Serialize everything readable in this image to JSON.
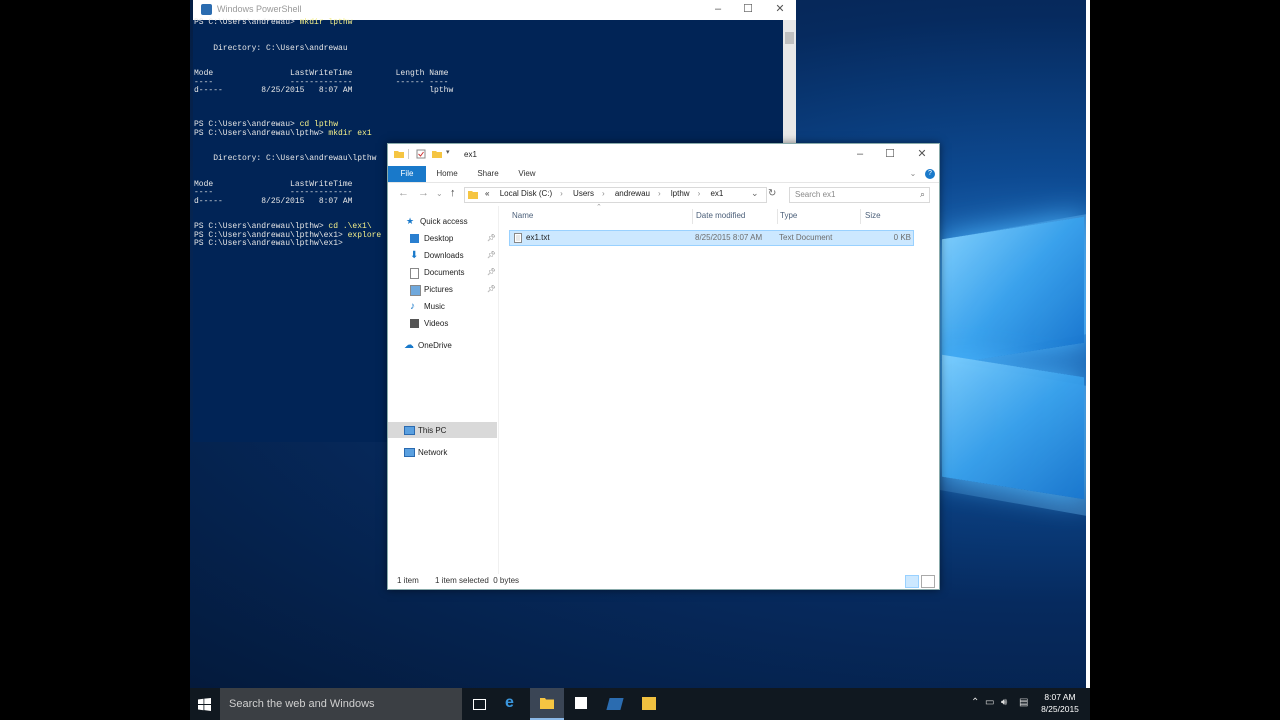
{
  "powershell": {
    "title": "Windows PowerShell",
    "lines": [
      {
        "prompt": "PS C:\\Users\\andrewau> ",
        "cmd": "mkdir lpthw"
      },
      {
        "text": ""
      },
      {
        "text": ""
      },
      {
        "text": "    Directory: C:\\Users\\andrewau"
      },
      {
        "text": ""
      },
      {
        "text": ""
      },
      {
        "text": "Mode                LastWriteTime         Length Name"
      },
      {
        "text": "----                -------------         ------ ----"
      },
      {
        "text": "d-----        8/25/2015   8:07 AM                lpthw"
      },
      {
        "text": ""
      },
      {
        "text": ""
      },
      {
        "text": ""
      },
      {
        "prompt": "PS C:\\Users\\andrewau> ",
        "cmd": "cd lpthw"
      },
      {
        "prompt": "PS C:\\Users\\andrewau\\lpthw> ",
        "cmd": "mkdir ex1"
      },
      {
        "text": ""
      },
      {
        "text": ""
      },
      {
        "text": "    Directory: C:\\Users\\andrewau\\lpthw"
      },
      {
        "text": ""
      },
      {
        "text": ""
      },
      {
        "text": "Mode                LastWriteTime"
      },
      {
        "text": "----                -------------"
      },
      {
        "text": "d-----        8/25/2015   8:07 AM"
      },
      {
        "text": ""
      },
      {
        "text": ""
      },
      {
        "prompt": "PS C:\\Users\\andrewau\\lpthw> ",
        "cmd": "cd .\\ex1\\"
      },
      {
        "prompt": "PS C:\\Users\\andrewau\\lpthw\\ex1> ",
        "cmd": "explore"
      },
      {
        "prompt": "PS C:\\Users\\andrewau\\lpthw\\ex1> ",
        "cmd": ""
      }
    ]
  },
  "explorer": {
    "title": "ex1",
    "tabs": [
      "File",
      "Home",
      "Share",
      "View"
    ],
    "breadcrumb_prefix": "«",
    "breadcrumbs": [
      "Local Disk (C:)",
      "Users",
      "andrewau",
      "lpthw",
      "ex1"
    ],
    "search_placeholder": "Search ex1",
    "nav": {
      "quick_access": "Quick access",
      "pinned": [
        "Desktop",
        "Downloads",
        "Documents",
        "Pictures"
      ],
      "unpinned": [
        "Music",
        "Videos"
      ],
      "onedrive": "OneDrive",
      "this_pc": "This PC",
      "network": "Network"
    },
    "columns": [
      "Name",
      "Date modified",
      "Type",
      "Size"
    ],
    "files": [
      {
        "name": "ex1.txt",
        "modified": "8/25/2015 8:07 AM",
        "type": "Text Document",
        "size": "0 KB"
      }
    ],
    "status_items": "1 item",
    "status_selected": "1 item selected  0 bytes"
  },
  "taskbar": {
    "search_placeholder": "Search the web and Windows",
    "time": "8:07 AM",
    "date": "8/25/2015"
  },
  "colors": {
    "ps_bg": "#012456",
    "ps_cmd": "#f5f08a",
    "accent": "#1979ca",
    "selection": "#cce8ff"
  }
}
